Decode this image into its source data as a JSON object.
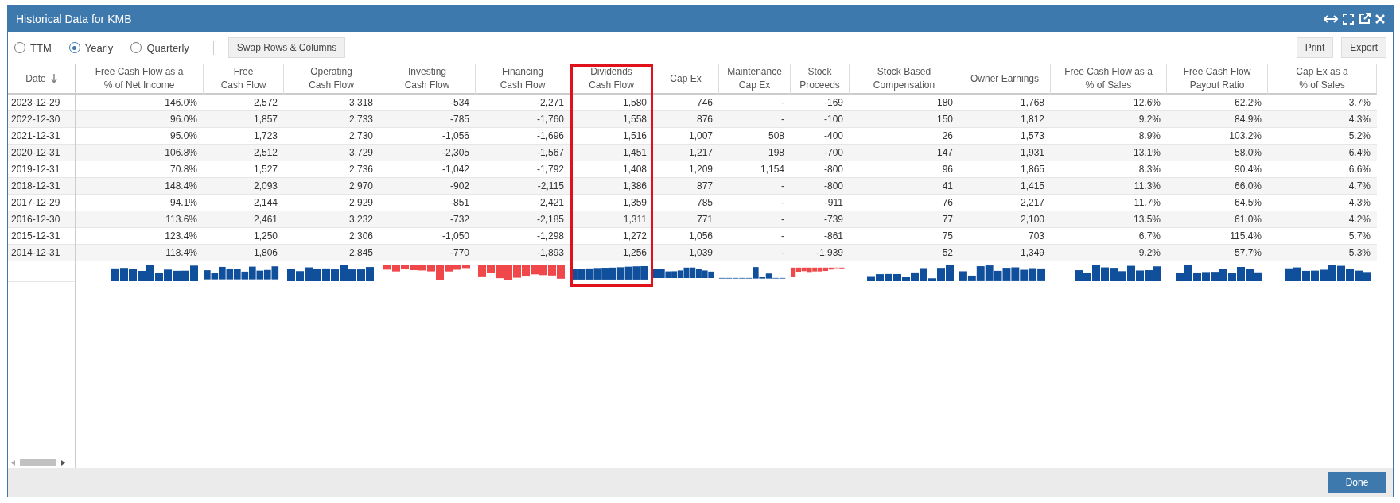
{
  "window": {
    "title": "Historical Data for KMB"
  },
  "toolbar": {
    "period_options": [
      {
        "label": "TTM",
        "selected": false
      },
      {
        "label": "Yearly",
        "selected": true
      },
      {
        "label": "Quarterly",
        "selected": false
      }
    ],
    "swap_button": "Swap Rows & Columns",
    "right_buttons": [
      "Print",
      "Export"
    ]
  },
  "table": {
    "date_header": "Date",
    "dates": [
      "2023-12-29",
      "2022-12-30",
      "2021-12-31",
      "2020-12-31",
      "2019-12-31",
      "2018-12-31",
      "2017-12-29",
      "2016-12-30",
      "2015-12-31",
      "2014-12-31"
    ],
    "columns": [
      {
        "header": [
          "Free Cash Flow as a",
          "% of Net Income"
        ],
        "highlighted": false,
        "values": [
          "146.0%",
          "96.0%",
          "95.0%",
          "106.8%",
          "70.8%",
          "148.4%",
          "94.1%",
          "113.6%",
          "123.4%",
          "118.4%"
        ]
      },
      {
        "header": [
          "Free",
          "Cash Flow"
        ],
        "highlighted": false,
        "values": [
          "2,572",
          "1,857",
          "1,723",
          "2,512",
          "1,527",
          "2,093",
          "2,144",
          "2,461",
          "1,250",
          "1,806"
        ]
      },
      {
        "header": [
          "Operating",
          "Cash Flow"
        ],
        "highlighted": false,
        "values": [
          "3,318",
          "2,733",
          "2,730",
          "3,729",
          "2,736",
          "2,970",
          "2,929",
          "3,232",
          "2,306",
          "2,845"
        ]
      },
      {
        "header": [
          "Investing",
          "Cash Flow"
        ],
        "highlighted": false,
        "values": [
          "-534",
          "-785",
          "-1,056",
          "-2,305",
          "-1,042",
          "-902",
          "-851",
          "-732",
          "-1,050",
          "-770"
        ]
      },
      {
        "header": [
          "Financing",
          "Cash Flow"
        ],
        "highlighted": false,
        "values": [
          "-2,271",
          "-1,760",
          "-1,696",
          "-1,567",
          "-1,792",
          "-2,115",
          "-2,421",
          "-2,185",
          "-1,298",
          "-1,893"
        ]
      },
      {
        "header": [
          "Dividends",
          "Cash Flow"
        ],
        "highlighted": true,
        "values": [
          "1,580",
          "1,558",
          "1,516",
          "1,451",
          "1,408",
          "1,386",
          "1,359",
          "1,311",
          "1,272",
          "1,256"
        ]
      },
      {
        "header": [
          "Cap Ex"
        ],
        "highlighted": false,
        "values": [
          "746",
          "876",
          "1,007",
          "1,217",
          "1,209",
          "877",
          "785",
          "771",
          "1,056",
          "1,039"
        ]
      },
      {
        "header": [
          "Maintenance",
          "Cap Ex"
        ],
        "highlighted": false,
        "values": [
          "-",
          "-",
          "508",
          "198",
          "1,154",
          "-",
          "-",
          "-",
          "-",
          "-"
        ]
      },
      {
        "header": [
          "Stock",
          "Proceeds"
        ],
        "highlighted": false,
        "values": [
          "-169",
          "-100",
          "-400",
          "-700",
          "-800",
          "-800",
          "-911",
          "-739",
          "-861",
          "-1,939"
        ]
      },
      {
        "header": [
          "Stock Based",
          "Compensation"
        ],
        "highlighted": false,
        "values": [
          "180",
          "150",
          "26",
          "147",
          "96",
          "41",
          "76",
          "77",
          "75",
          "52"
        ]
      },
      {
        "header": [
          "Owner Earnings"
        ],
        "highlighted": false,
        "values": [
          "1,768",
          "1,812",
          "1,573",
          "1,931",
          "1,865",
          "1,415",
          "2,217",
          "2,100",
          "703",
          "1,349"
        ]
      },
      {
        "header": [
          "Free Cash Flow as a",
          "% of Sales"
        ],
        "highlighted": false,
        "values": [
          "12.6%",
          "9.2%",
          "8.9%",
          "13.1%",
          "8.3%",
          "11.3%",
          "11.7%",
          "13.5%",
          "6.7%",
          "9.2%"
        ]
      },
      {
        "header": [
          "Free Cash Flow",
          "Payout Ratio"
        ],
        "highlighted": false,
        "values": [
          "62.2%",
          "84.9%",
          "103.2%",
          "58.0%",
          "90.4%",
          "66.0%",
          "64.5%",
          "61.0%",
          "115.4%",
          "57.7%"
        ]
      },
      {
        "header": [
          "Cap Ex as a",
          "% of Sales"
        ],
        "highlighted": false,
        "values": [
          "3.7%",
          "4.3%",
          "5.2%",
          "6.4%",
          "6.6%",
          "4.7%",
          "4.3%",
          "4.2%",
          "5.7%",
          "5.3%"
        ]
      }
    ]
  },
  "footer": {
    "done_button": "Done"
  }
}
